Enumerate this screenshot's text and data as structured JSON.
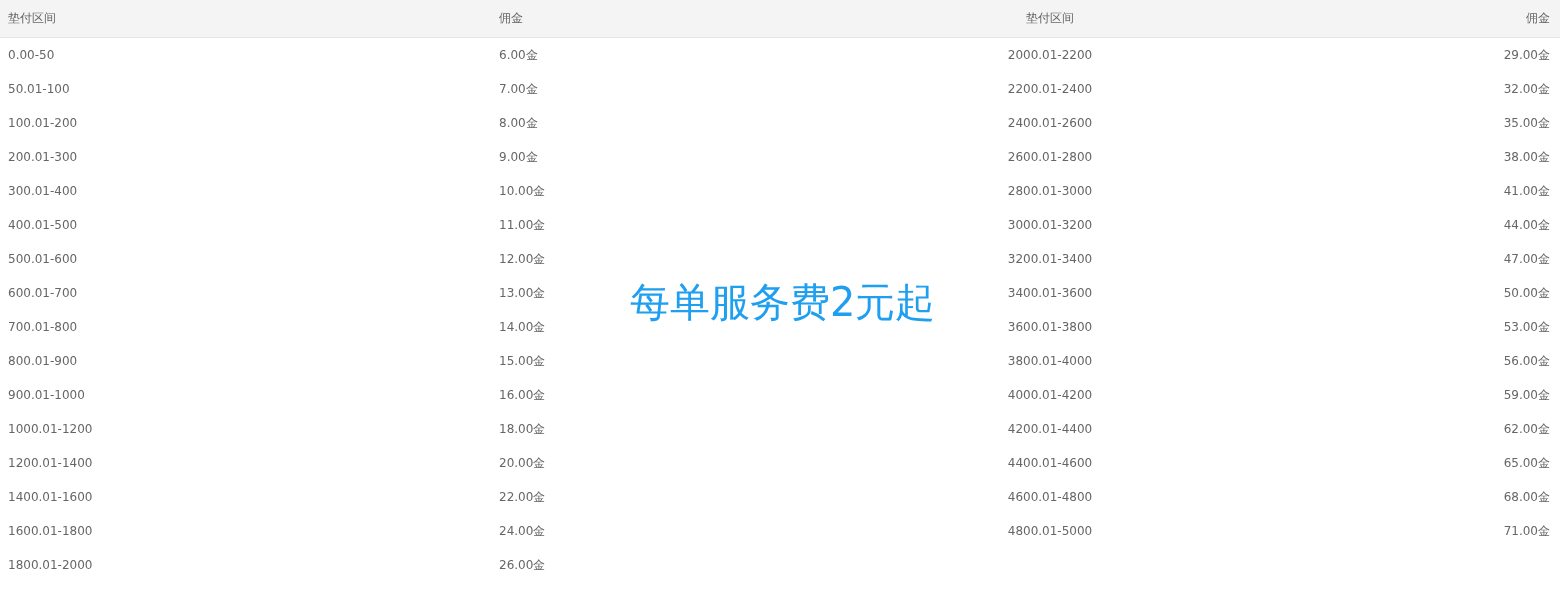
{
  "table": {
    "columns": [
      "垫付区间",
      "佣金",
      "垫付区间",
      "佣金"
    ],
    "rows": [
      [
        "0.00-50",
        "6.00金",
        "2000.01-2200",
        "29.00金"
      ],
      [
        "50.01-100",
        "7.00金",
        "2200.01-2400",
        "32.00金"
      ],
      [
        "100.01-200",
        "8.00金",
        "2400.01-2600",
        "35.00金"
      ],
      [
        "200.01-300",
        "9.00金",
        "2600.01-2800",
        "38.00金"
      ],
      [
        "300.01-400",
        "10.00金",
        "2800.01-3000",
        "41.00金"
      ],
      [
        "400.01-500",
        "11.00金",
        "3000.01-3200",
        "44.00金"
      ],
      [
        "500.01-600",
        "12.00金",
        "3200.01-3400",
        "47.00金"
      ],
      [
        "600.01-700",
        "13.00金",
        "3400.01-3600",
        "50.00金"
      ],
      [
        "700.01-800",
        "14.00金",
        "3600.01-3800",
        "53.00金"
      ],
      [
        "800.01-900",
        "15.00金",
        "3800.01-4000",
        "56.00金"
      ],
      [
        "900.01-1000",
        "16.00金",
        "4000.01-4200",
        "59.00金"
      ],
      [
        "1000.01-1200",
        "18.00金",
        "4200.01-4400",
        "62.00金"
      ],
      [
        "1200.01-1400",
        "20.00金",
        "4400.01-4600",
        "65.00金"
      ],
      [
        "1400.01-1600",
        "22.00金",
        "4600.01-4800",
        "68.00金"
      ],
      [
        "1600.01-1800",
        "24.00金",
        "4800.01-5000",
        "71.00金"
      ],
      [
        "1800.01-2000",
        "26.00金"
      ]
    ]
  },
  "notice": "每单服务费2元起"
}
